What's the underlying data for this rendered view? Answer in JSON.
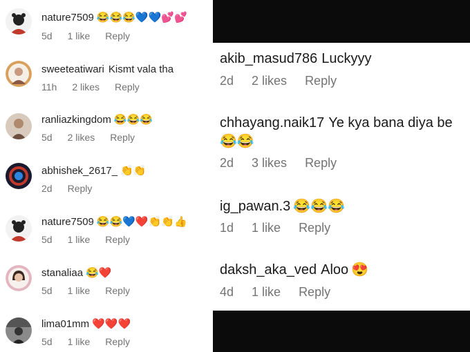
{
  "left_comments": [
    {
      "user": "nature7509",
      "text": "",
      "emoji": "😂😂😂💙💙💕💕",
      "time": "5d",
      "likes": "1 like",
      "reply": "Reply"
    },
    {
      "user": "sweeteatiwari",
      "text": "Kismt vala tha",
      "emoji": "",
      "time": "11h",
      "likes": "2 likes",
      "reply": "Reply"
    },
    {
      "user": "ranliazkingdom",
      "text": "",
      "emoji": "😂😂😂",
      "time": "5d",
      "likes": "2 likes",
      "reply": "Reply"
    },
    {
      "user": "abhishek_2617_",
      "text": "",
      "emoji": "👏👏",
      "time": "2d",
      "likes": "",
      "reply": "Reply"
    },
    {
      "user": "nature7509",
      "text": "",
      "emoji": "😂😂💙❤️👏👏👍",
      "time": "5d",
      "likes": "1 like",
      "reply": "Reply"
    },
    {
      "user": "stanaliaa",
      "text": "",
      "emoji": "😂❤️",
      "time": "5d",
      "likes": "1 like",
      "reply": "Reply"
    },
    {
      "user": "lima01mm",
      "text": "",
      "emoji": "❤️❤️❤️",
      "time": "5d",
      "likes": "1 like",
      "reply": "Reply"
    }
  ],
  "right_comments": [
    {
      "user": "akib_masud786",
      "text": "Luckyyy",
      "emoji": "",
      "emoji2": "",
      "time": "2d",
      "likes": "2 likes",
      "reply": "Reply"
    },
    {
      "user": "chhayang.naik17",
      "text": "Ye kya bana diya be",
      "emoji": "",
      "emoji2": "😂😂",
      "time": "2d",
      "likes": "3 likes",
      "reply": "Reply"
    },
    {
      "user": "ig_pawan.3",
      "text": "",
      "emoji": "😂😂😂",
      "emoji2": "",
      "time": "1d",
      "likes": "1 like",
      "reply": "Reply"
    },
    {
      "user": "daksh_aka_ved",
      "text": "Aloo",
      "emoji": "😍",
      "emoji2": "",
      "time": "4d",
      "likes": "1 like",
      "reply": "Reply"
    }
  ]
}
